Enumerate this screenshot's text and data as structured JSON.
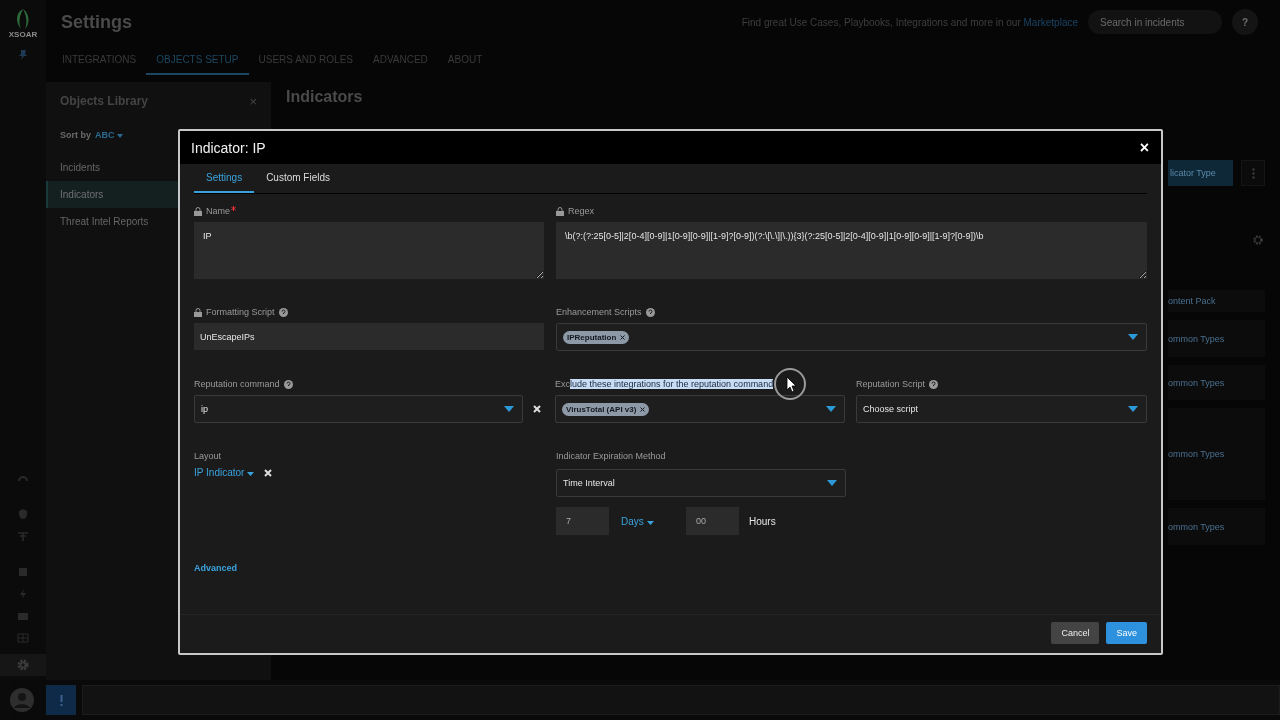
{
  "app": {
    "logo_text": "XSOAR",
    "page_title": "Settings",
    "nav_tabs": [
      {
        "label": "INTEGRATIONS",
        "selected": false
      },
      {
        "label": "OBJECTS SETUP",
        "selected": true
      },
      {
        "label": "USERS AND ROLES",
        "selected": false
      },
      {
        "label": "ADVANCED",
        "selected": false
      },
      {
        "label": "ABOUT",
        "selected": false
      }
    ],
    "marketplace_text": "Find great Use Cases, Playbooks, Integrations and more in our",
    "marketplace_link": "Marketplace",
    "search": {
      "placeholder": "Search in incidents"
    },
    "help": "?"
  },
  "library": {
    "title": "Objects Library",
    "close": "×",
    "sort_label": "Sort by",
    "sort_value": "ABC",
    "items": [
      {
        "label": "Incidents",
        "selected": false
      },
      {
        "label": "Indicators",
        "selected": true
      },
      {
        "label": "Threat Intel Reports",
        "selected": false
      }
    ]
  },
  "main": {
    "title": "Indicators",
    "new_button": "licator Type",
    "table_header": "ontent Pack",
    "rows": [
      "ommon Types",
      "ommon Types",
      "ommon Types",
      "ommon Types"
    ]
  },
  "dialog": {
    "title": "Indicator: IP",
    "close": "×",
    "tabs": [
      {
        "label": "Settings",
        "selected": true
      },
      {
        "label": "Custom Fields",
        "selected": false
      }
    ],
    "name": {
      "label": "Name",
      "locked": true,
      "required": true,
      "value": "IP"
    },
    "regex": {
      "label": "Regex",
      "locked": true,
      "value": "\\b(?:(?:25[0-5]|2[0-4][0-9]|1[0-9][0-9]|[1-9]?[0-9])(?:\\[\\.\\]|\\.)){3}(?:25[0-5]|2[0-4][0-9]|1[0-9][0-9]|[1-9]?[0-9])\\b"
    },
    "formatting_script": {
      "label": "Formatting Script",
      "locked": true,
      "help": true,
      "value": "UnEscapeIPs"
    },
    "enhancement_scripts": {
      "label": "Enhancement Scripts",
      "help": true,
      "chips": [
        "IPReputation"
      ]
    },
    "reputation_command": {
      "label": "Reputation command",
      "help": true,
      "value": "ip"
    },
    "exclude_integrations": {
      "label_before_selection": "Exc",
      "label_selected": "lude these integrations for the reputation command",
      "chips": [
        "VirusTotal (API v3)"
      ]
    },
    "reputation_script": {
      "label": "Reputation Script",
      "help": true,
      "value": "Choose script"
    },
    "layout": {
      "label": "Layout",
      "value": "IP Indicator"
    },
    "expiration": {
      "label": "Indicator Expiration Method",
      "value": "Time Interval",
      "amount": "7",
      "unit": "Days",
      "hours": "00",
      "hours_label": "Hours"
    },
    "advanced_link": "Advanced",
    "buttons": [
      {
        "label": "Cancel",
        "kind": "secondary"
      },
      {
        "label": "Save",
        "kind": "primary"
      }
    ]
  }
}
